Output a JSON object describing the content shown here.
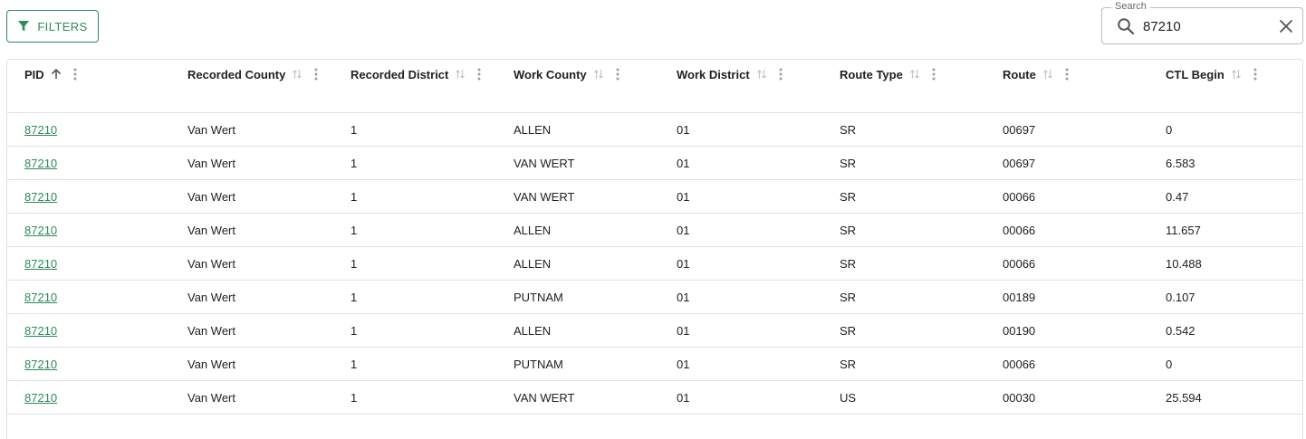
{
  "toolbar": {
    "filters_label": "FILTERS",
    "filter_icon": "filter-icon"
  },
  "search": {
    "label": "Search",
    "value": "87210",
    "search_icon": "search-icon",
    "clear_icon": "close-icon"
  },
  "colors": {
    "accent": "#2e8b57",
    "border": "#e0e0e0",
    "text": "#212121"
  },
  "table": {
    "columns": [
      {
        "label": "PID",
        "sort": "asc"
      },
      {
        "label": "Recorded County",
        "sort": "none"
      },
      {
        "label": "Recorded District",
        "sort": "none"
      },
      {
        "label": "Work County",
        "sort": "none"
      },
      {
        "label": "Work District",
        "sort": "none"
      },
      {
        "label": "Route Type",
        "sort": "none"
      },
      {
        "label": "Route",
        "sort": "none"
      },
      {
        "label": "CTL Begin",
        "sort": "none"
      }
    ],
    "rows": [
      [
        "87210",
        "Van Wert",
        "1",
        "ALLEN",
        "01",
        "SR",
        "00697",
        "0"
      ],
      [
        "87210",
        "Van Wert",
        "1",
        "VAN WERT",
        "01",
        "SR",
        "00697",
        "6.583"
      ],
      [
        "87210",
        "Van Wert",
        "1",
        "VAN WERT",
        "01",
        "SR",
        "00066",
        "0.47"
      ],
      [
        "87210",
        "Van Wert",
        "1",
        "ALLEN",
        "01",
        "SR",
        "00066",
        "11.657"
      ],
      [
        "87210",
        "Van Wert",
        "1",
        "ALLEN",
        "01",
        "SR",
        "00066",
        "10.488"
      ],
      [
        "87210",
        "Van Wert",
        "1",
        "PUTNAM",
        "01",
        "SR",
        "00189",
        "0.107"
      ],
      [
        "87210",
        "Van Wert",
        "1",
        "ALLEN",
        "01",
        "SR",
        "00190",
        "0.542"
      ],
      [
        "87210",
        "Van Wert",
        "1",
        "PUTNAM",
        "01",
        "SR",
        "00066",
        "0"
      ],
      [
        "87210",
        "Van Wert",
        "1",
        "VAN WERT",
        "01",
        "US",
        "00030",
        "25.594"
      ]
    ]
  }
}
